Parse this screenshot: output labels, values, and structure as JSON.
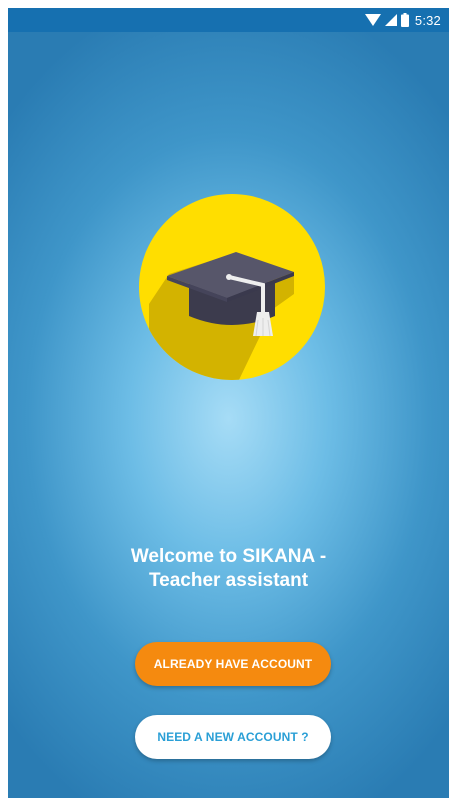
{
  "status_bar": {
    "time": "5:32",
    "icons": [
      "wifi-icon",
      "cell-signal-icon",
      "battery-icon"
    ],
    "background": "#1670b0"
  },
  "logo": {
    "icon": "graduation-cap-icon",
    "circle_color": "#ffde00",
    "cap_color": "#4b4a5c",
    "tassel_color": "#eeeeee"
  },
  "welcome": {
    "text": "Welcome to SIKANA -\nTeacher assistant"
  },
  "buttons": {
    "login_label": "ALREADY HAVE ACCOUNT",
    "signup_label": "NEED A NEW ACCOUNT ?",
    "login_color": "#f58a0f",
    "signup_text_color": "#2a9fd6"
  }
}
